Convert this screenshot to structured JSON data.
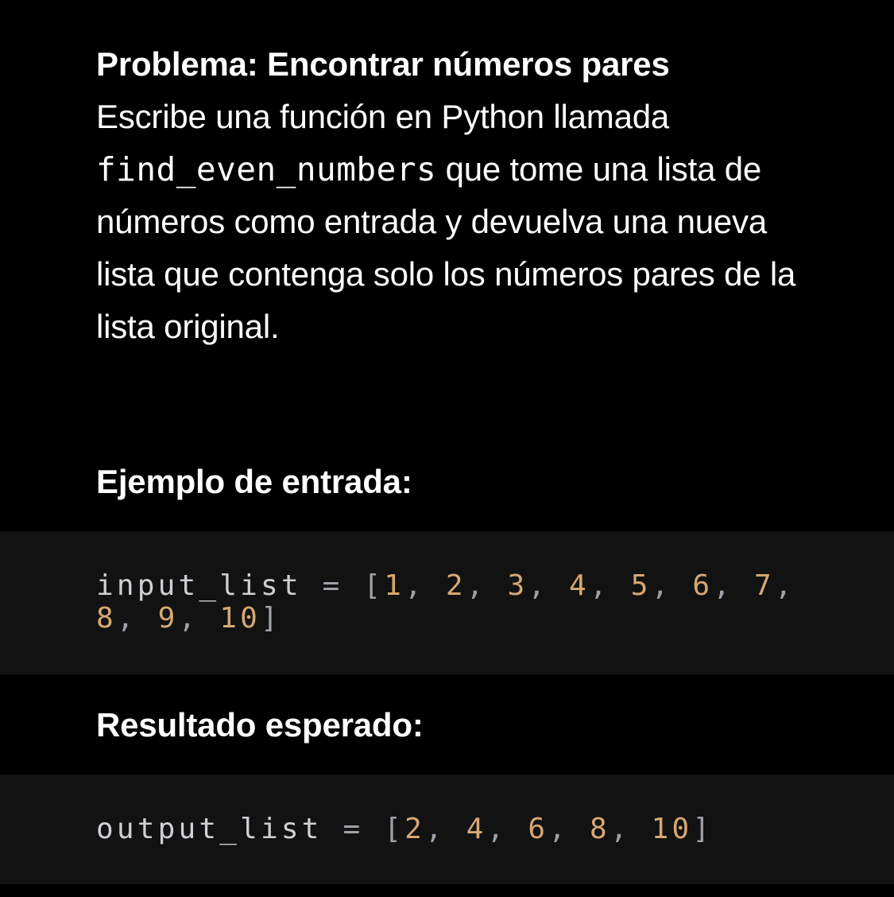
{
  "problem": {
    "title": "Problema: Encontrar números pares",
    "text_before": "Escribe una función en Python llamada ",
    "function_name": "find_even_numbers",
    "text_after": " que tome una lista de números como entrada y devuelva una nueva lista que contenga solo los números pares de la lista original."
  },
  "example_heading": "Ejemplo de entrada:",
  "input_code": {
    "variable": "input_list",
    "operator": "=",
    "open_bracket": "[",
    "close_bracket": "]",
    "values": [
      "1",
      "2",
      "3",
      "4",
      "5",
      "6",
      "7",
      "8",
      "9",
      "10"
    ]
  },
  "result_heading": "Resultado esperado:",
  "output_code": {
    "variable": "output_list",
    "operator": "=",
    "open_bracket": "[",
    "close_bracket": "]",
    "values": [
      "2",
      "4",
      "6",
      "8",
      "10"
    ]
  },
  "colors": {
    "background": "#000000",
    "code_background": "#121212",
    "text": "#ffffff",
    "code_identifier": "#cfd0d6",
    "code_number": "#d6a872"
  }
}
